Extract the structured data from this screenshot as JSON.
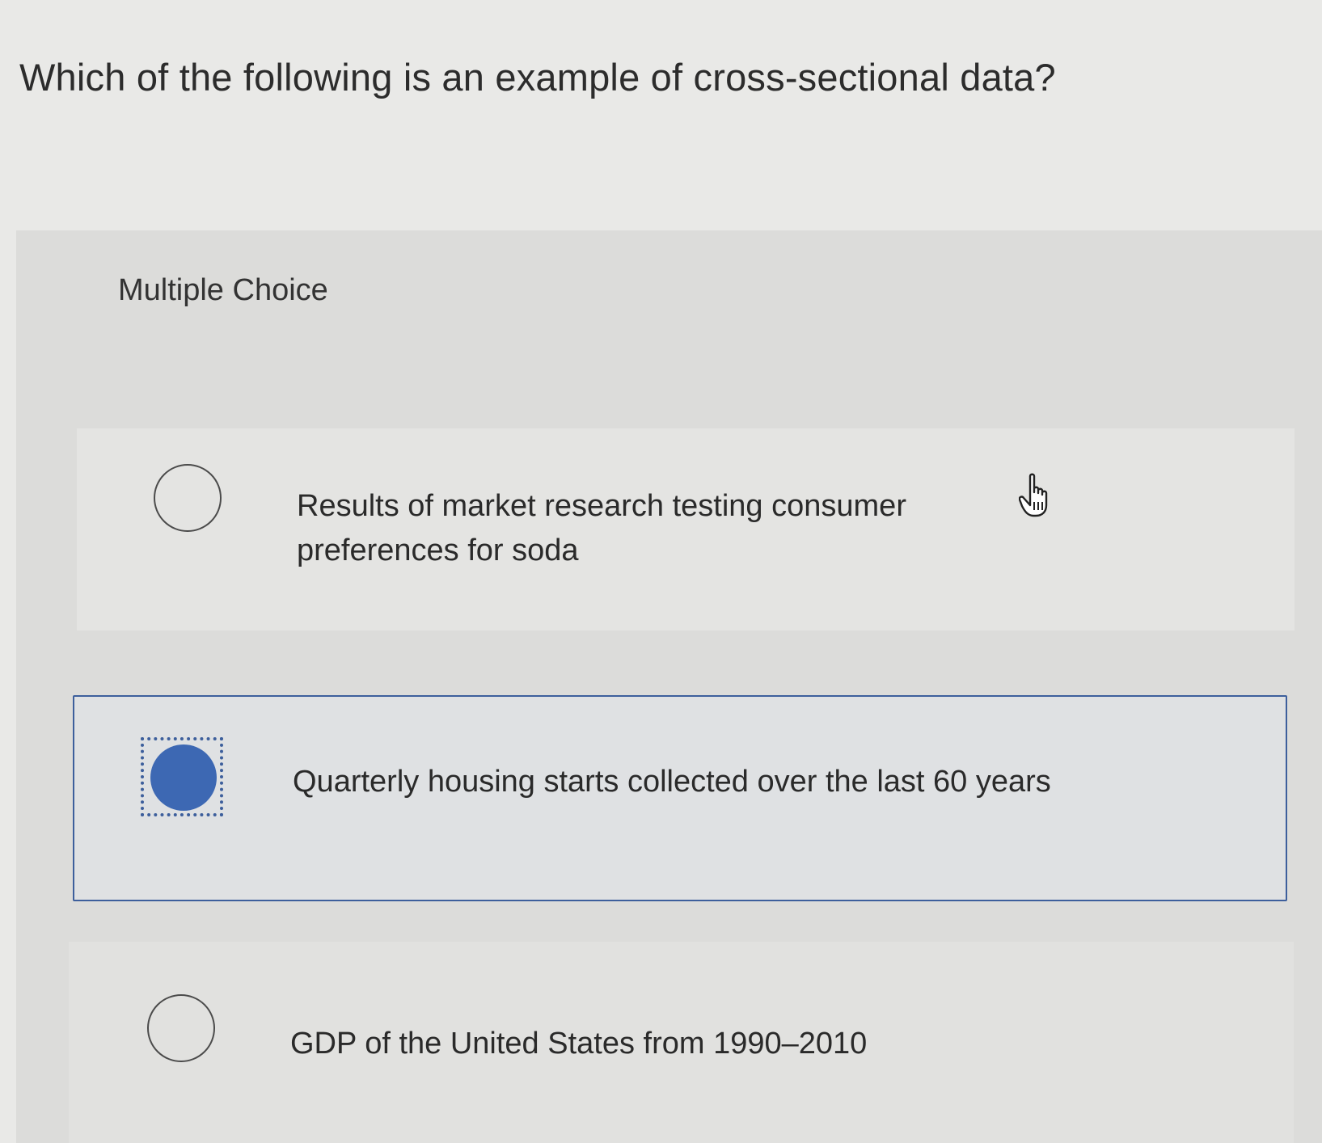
{
  "question": {
    "text": "Which of the following is an example of cross-sectional data?"
  },
  "panel": {
    "label": "Multiple Choice",
    "options": [
      {
        "text": "Results of market research testing consumer preferences for soda",
        "selected": false
      },
      {
        "text": "Quarterly housing starts collected over the last 60 years",
        "selected": true
      },
      {
        "text": "GDP of the United States from 1990–2010",
        "selected": false
      }
    ]
  },
  "colors": {
    "accent": "#3d68b3",
    "selected_border": "#3d5f9c"
  },
  "icons": {
    "cursor": "hand-pointer-icon"
  }
}
